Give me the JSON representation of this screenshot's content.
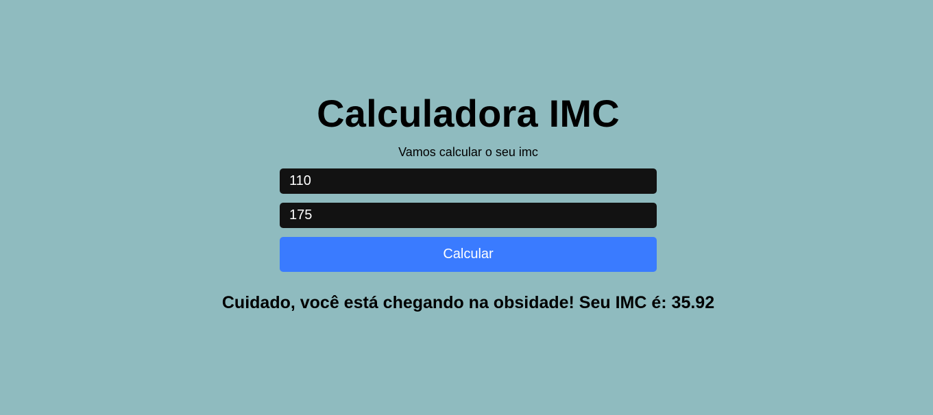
{
  "title": "Calculadora IMC",
  "subtitle": "Vamos calcular o seu imc",
  "form": {
    "weight_value": "110",
    "height_value": "175",
    "button_label": "Calcular"
  },
  "result": "Cuidado, você está chegando na obsidade! Seu IMC é: 35.92",
  "colors": {
    "background": "#8fbbbf",
    "input_background": "#121212",
    "button_background": "#3a7bff",
    "text": "#000000"
  }
}
